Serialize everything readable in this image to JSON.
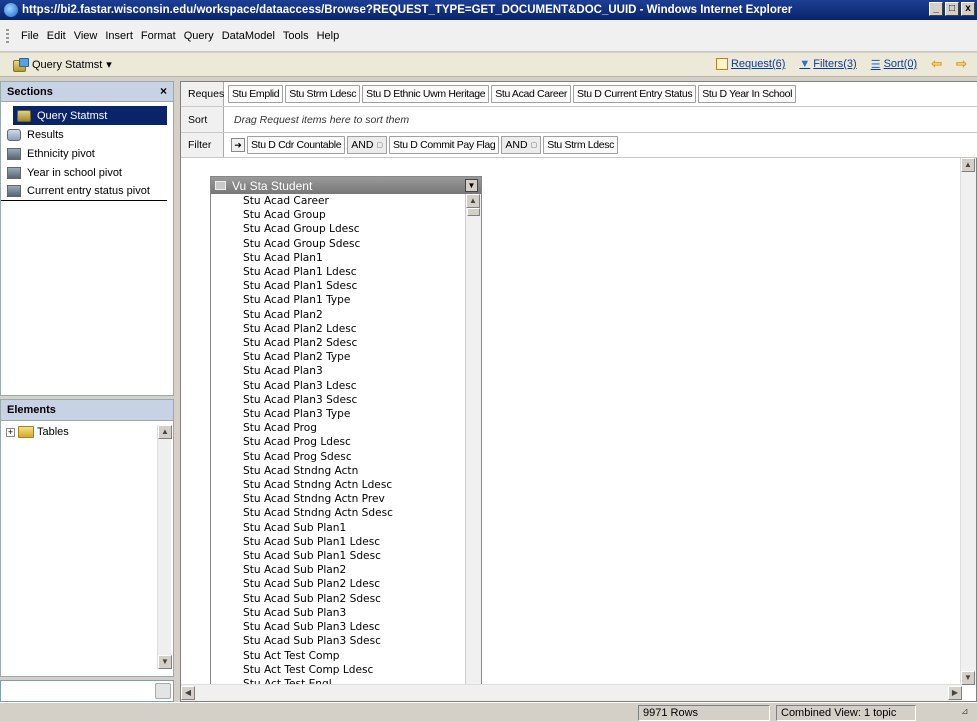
{
  "window": {
    "title": "https://bi2.fastar.wisconsin.edu/workspace/dataaccess/Browse?REQUEST_TYPE=GET_DOCUMENT&DOC_UUID - Windows Internet Explorer",
    "minimize": "_",
    "restore": "□",
    "close": "x"
  },
  "menu": [
    "File",
    "Edit",
    "View",
    "Insert",
    "Format",
    "Query",
    "DataModel",
    "Tools",
    "Help"
  ],
  "toolbar": {
    "query_label": "Query Statmst",
    "query_caret": "▾",
    "request_link": "Request(6)",
    "filters_link": "Filters(3)",
    "sort_link": "Sort(0)"
  },
  "sections": {
    "title": "Sections",
    "close": "×",
    "items": [
      {
        "label": "Query Statmst",
        "icon": "query-icon"
      },
      {
        "label": "Results",
        "icon": "results-icon"
      },
      {
        "label": "Ethnicity pivot",
        "icon": "pivot-icon"
      },
      {
        "label": "Year in school pivot",
        "icon": "pivot-icon"
      },
      {
        "label": "Current entry status pivot",
        "icon": "pivot-icon"
      }
    ]
  },
  "elements": {
    "title": "Elements",
    "tree": [
      {
        "label": "Tables",
        "expander": "+"
      }
    ]
  },
  "query": {
    "request_label": "Request",
    "request_items": [
      "Stu Emplid",
      "Stu Strm Ldesc",
      "Stu D Ethnic Uwm Heritage",
      "Stu Acad Career",
      "Stu D Current Entry Status",
      "Stu D Year In School"
    ],
    "sort_label": "Sort",
    "sort_hint": "Drag Request items here to sort them",
    "filter_label": "Filter",
    "filter_items": [
      "Stu D Cdr Countable",
      "Stu D Commit Pay Flag",
      "Stu Strm Ldesc"
    ],
    "filter_operator": "AND"
  },
  "table": {
    "name": "Vu Sta Student",
    "columns": [
      "Stu Acad Career",
      "Stu Acad Group",
      "Stu Acad Group Ldesc",
      "Stu Acad Group Sdesc",
      "Stu Acad Plan1",
      "Stu Acad Plan1 Ldesc",
      "Stu Acad Plan1 Sdesc",
      "Stu Acad Plan1 Type",
      "Stu Acad Plan2",
      "Stu Acad Plan2 Ldesc",
      "Stu Acad Plan2 Sdesc",
      "Stu Acad Plan2 Type",
      "Stu Acad Plan3",
      "Stu Acad Plan3 Ldesc",
      "Stu Acad Plan3 Sdesc",
      "Stu Acad Plan3 Type",
      "Stu Acad Prog",
      "Stu Acad Prog Ldesc",
      "Stu Acad Prog Sdesc",
      "Stu Acad Stndng Actn",
      "Stu Acad Stndng Actn Ldesc",
      "Stu Acad Stndng Actn Prev",
      "Stu Acad Stndng Actn Sdesc",
      "Stu Acad Sub Plan1",
      "Stu Acad Sub Plan1 Ldesc",
      "Stu Acad Sub Plan1 Sdesc",
      "Stu Acad Sub Plan2",
      "Stu Acad Sub Plan2 Ldesc",
      "Stu Acad Sub Plan2 Sdesc",
      "Stu Acad Sub Plan3",
      "Stu Acad Sub Plan3 Ldesc",
      "Stu Acad Sub Plan3 Sdesc",
      "Stu Act Test Comp",
      "Stu Act Test Comp Ldesc",
      "Stu Act Test Engl"
    ]
  },
  "status": {
    "rows": "9971 Rows",
    "view": "Combined View: 1 topic"
  },
  "colors": {
    "titlebar": "#0a246a",
    "selection": "#0a246a",
    "panel_header": "#c7d2e4",
    "link": "#0b3a9c"
  }
}
